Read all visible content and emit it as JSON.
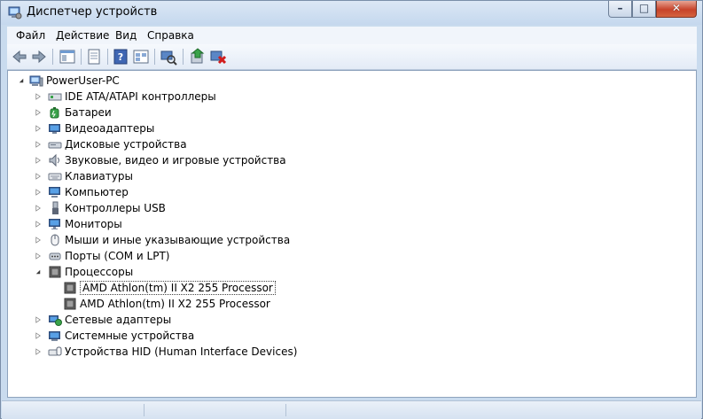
{
  "window": {
    "title": "Диспетчер устройств"
  },
  "menu": {
    "items": [
      "Файл",
      "Действие",
      "Вид",
      "Справка"
    ]
  },
  "toolbar": {
    "icons": [
      "back-arrow-icon",
      "forward-arrow-icon",
      "show-hide-tree-icon",
      "properties-icon",
      "help-icon",
      "view-icon",
      "scan-hardware-icon",
      "update-driver-icon",
      "uninstall-icon"
    ]
  },
  "tree": {
    "root": "PowerUser-PC",
    "categories": [
      {
        "label": "IDE ATA/ATAPI контроллеры",
        "icon": "ide-controller-icon",
        "expanded": false
      },
      {
        "label": "Батареи",
        "icon": "battery-icon",
        "expanded": false
      },
      {
        "label": "Видеоадаптеры",
        "icon": "display-adapter-icon",
        "expanded": false
      },
      {
        "label": "Дисковые устройства",
        "icon": "disk-drive-icon",
        "expanded": false
      },
      {
        "label": "Звуковые, видео и игровые устройства",
        "icon": "speaker-icon",
        "expanded": false
      },
      {
        "label": "Клавиатуры",
        "icon": "keyboard-icon",
        "expanded": false
      },
      {
        "label": "Компьютер",
        "icon": "computer-icon",
        "expanded": false
      },
      {
        "label": "Контроллеры USB",
        "icon": "usb-icon",
        "expanded": false
      },
      {
        "label": "Мониторы",
        "icon": "monitor-icon",
        "expanded": false
      },
      {
        "label": "Мыши и иные указывающие устройства",
        "icon": "mouse-icon",
        "expanded": false
      },
      {
        "label": "Порты (COM и LPT)",
        "icon": "port-icon",
        "expanded": false
      },
      {
        "label": "Процессоры",
        "icon": "processor-icon",
        "expanded": true,
        "children": [
          {
            "label": "AMD Athlon(tm) II X2 255 Processor",
            "selected": true
          },
          {
            "label": "AMD Athlon(tm) II X2 255 Processor",
            "selected": false
          }
        ]
      },
      {
        "label": "Сетевые адаптеры",
        "icon": "network-adapter-icon",
        "expanded": false
      },
      {
        "label": "Системные устройства",
        "icon": "system-devices-icon",
        "expanded": false
      },
      {
        "label": "Устройства HID (Human Interface Devices)",
        "icon": "hid-icon",
        "expanded": false
      }
    ]
  },
  "colors": {
    "titlebar": "#c9dbee",
    "close_button": "#c7432a",
    "selection_border": "#444444"
  }
}
